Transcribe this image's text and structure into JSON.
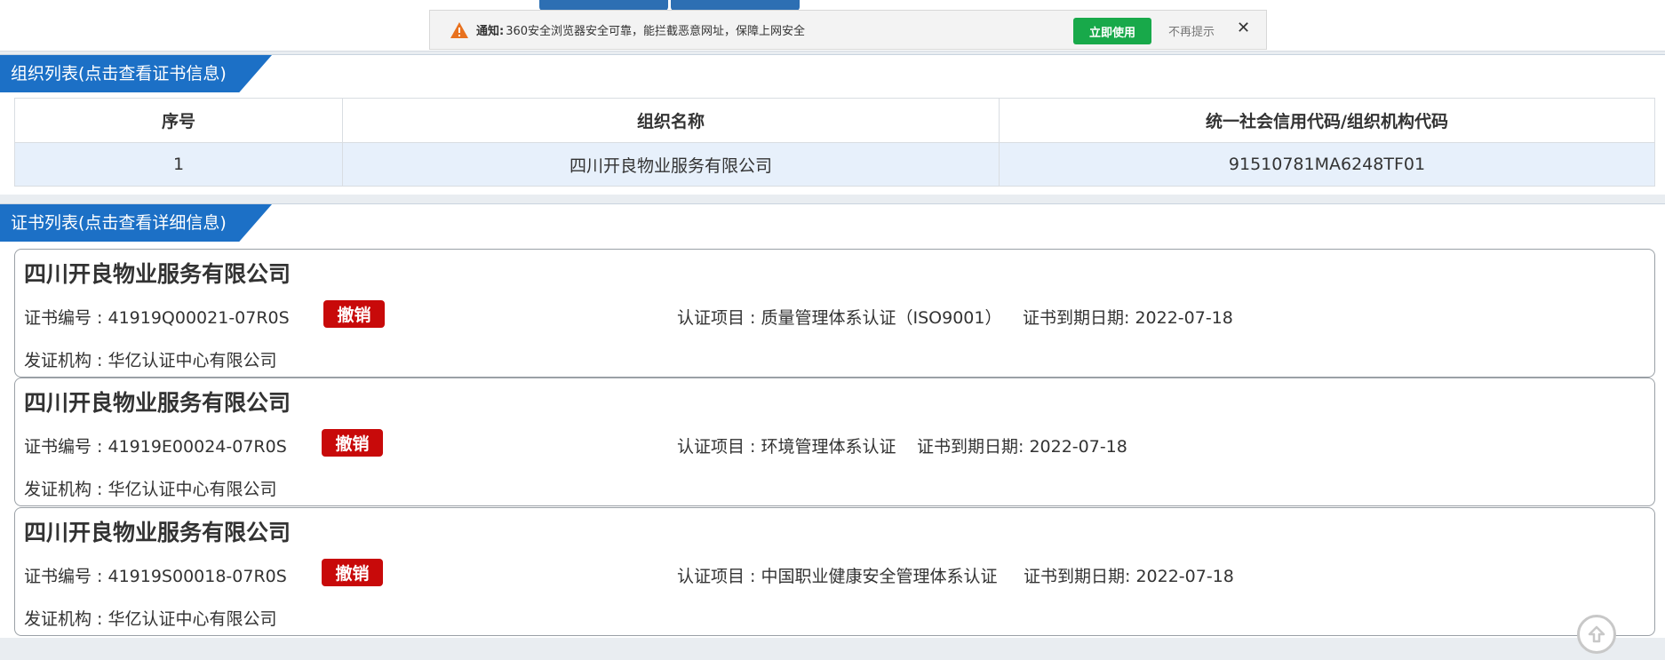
{
  "notice": {
    "label": "通知:",
    "message": "360安全浏览器安全可靠，能拦截恶意网址，保障上网安全",
    "use_button": "立即使用",
    "dont_show": "不再提示",
    "close": "✕",
    "icon": "warning-icon"
  },
  "org_panel": {
    "title": "组织列表(点击查看证书信息)",
    "headers": [
      "序号",
      "组织名称",
      "统一社会信用代码/组织机构代码"
    ],
    "rows": [
      {
        "index": "1",
        "name": "四川开良物业服务有限公司",
        "code": "91510781MA6248TF01"
      }
    ]
  },
  "cert_panel": {
    "title": "证书列表(点击查看详细信息)",
    "certs": [
      {
        "company": "四川开良物业服务有限公司",
        "cert_no": "证书编号 : 41919Q00021-07R0S",
        "status": "撤销",
        "project": "认证项目 : 质量管理体系认证（ISO9001）",
        "expiry": "证书到期日期: 2022-07-18",
        "issuer": "发证机构 : 华亿认证中心有限公司"
      },
      {
        "company": "四川开良物业服务有限公司",
        "cert_no": "证书编号 : 41919E00024-07R0S",
        "status": "撤销",
        "project": "认证项目 : 环境管理体系认证",
        "expiry": "证书到期日期: 2022-07-18",
        "issuer": "发证机构 : 华亿认证中心有限公司"
      },
      {
        "company": "四川开良物业服务有限公司",
        "cert_no": "证书编号 : 41919S00018-07R0S",
        "status": "撤销",
        "project": "认证项目 : 中国职业健康安全管理体系认证",
        "expiry": "证书到期日期: 2022-07-18",
        "issuer": "发证机构 : 华亿认证中心有限公司"
      }
    ]
  },
  "colors": {
    "accent_blue": "#1c70c6",
    "revoked_red": "#c80a0a",
    "use_green": "#18a94a",
    "row_highlight": "#e7f0fb"
  },
  "scroll_top_icon": "arrow-up-circle-icon"
}
